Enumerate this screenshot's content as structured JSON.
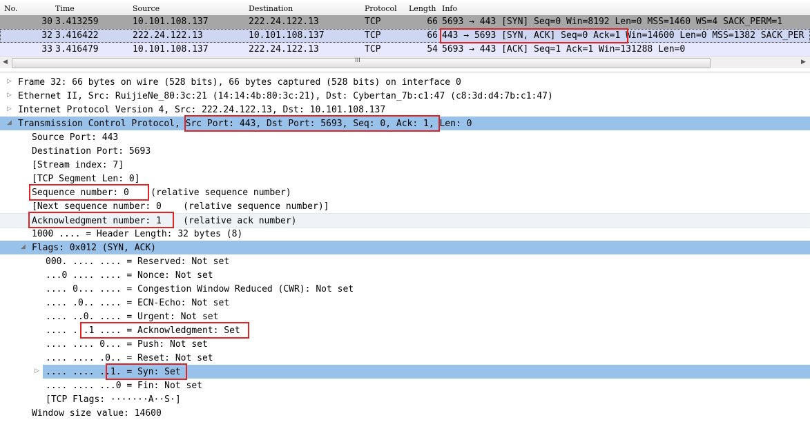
{
  "packet_list": {
    "columns": {
      "no": "No.",
      "time": "Time",
      "source": "Source",
      "destination": "Destination",
      "protocol": "Protocol",
      "length": "Length",
      "info": "Info"
    },
    "rows": [
      {
        "no": "30",
        "time": "3.413259",
        "source": "10.101.108.137",
        "destination": "222.24.122.13",
        "protocol": "TCP",
        "length": "66",
        "info": "5693 → 443 [SYN] Seq=0 Win=8192 Len=0 MSS=1460 WS=4 SACK_PERM=1"
      },
      {
        "no": "32",
        "time": "3.416422",
        "source": "222.24.122.13",
        "destination": "10.101.108.137",
        "protocol": "TCP",
        "length": "66",
        "info": "443 → 5693 [SYN, ACK] Seq=0 Ack=1 Win=14600 Len=0 MSS=1382 SACK_PER"
      },
      {
        "no": "33",
        "time": "3.416479",
        "source": "10.101.108.137",
        "destination": "222.24.122.13",
        "protocol": "TCP",
        "length": "54",
        "info": "5693 → 443 [ACK] Seq=1 Ack=1 Win=131288 Len=0"
      }
    ],
    "scrollbar_grip": "III"
  },
  "detail_tree": [
    {
      "text": "Frame 32: 66 bytes on wire (528 bits), 66 bytes captured (528 bits) on interface 0",
      "arrow": "▷"
    },
    {
      "text": "Ethernet II, Src: RuijieNe_80:3c:21 (14:14:4b:80:3c:21), Dst: Cybertan_7b:c1:47 (c8:3d:d4:7b:c1:47)",
      "arrow": "▷"
    },
    {
      "text": "Internet Protocol Version 4, Src: 222.24.122.13, Dst: 10.101.108.137",
      "arrow": "▷"
    },
    {
      "text": "Transmission Control Protocol, Src Port: 443, Dst Port: 5693, Seq: 0, Ack: 1, Len: 0",
      "arrow": "◢"
    },
    {
      "text": "Source Port: 443"
    },
    {
      "text": "Destination Port: 5693"
    },
    {
      "text": "[Stream index: 7]"
    },
    {
      "text": "[TCP Segment Len: 0]"
    },
    {
      "text": "Sequence number: 0    (relative sequence number)"
    },
    {
      "text": "[Next sequence number: 0    (relative sequence number)]"
    },
    {
      "text": "Acknowledgment number: 1    (relative ack number)"
    },
    {
      "text": "1000 .... = Header Length: 32 bytes (8)"
    },
    {
      "text": "Flags: 0x012 (SYN, ACK)",
      "arrow": "◢"
    },
    {
      "text": "000. .... .... = Reserved: Not set"
    },
    {
      "text": "...0 .... .... = Nonce: Not set"
    },
    {
      "text": ".... 0... .... = Congestion Window Reduced (CWR): Not set"
    },
    {
      "text": ".... .0.. .... = ECN-Echo: Not set"
    },
    {
      "text": ".... ..0. .... = Urgent: Not set"
    },
    {
      "text": ".... ...1 .... = Acknowledgment: Set"
    },
    {
      "text": ".... .... 0... = Push: Not set"
    },
    {
      "text": ".... .... .0.. = Reset: Not set"
    },
    {
      "text": ".... .... ..1. = Syn: Set",
      "arrow": "▷"
    },
    {
      "text": ".... .... ...0 = Fin: Not set"
    },
    {
      "text": "[TCP Flags: ·······A··S·]"
    },
    {
      "text": "Window size value: 14600"
    }
  ],
  "colors": {
    "row30_bg": "#a6a6a6",
    "row32_bg": "#cfd6f1",
    "row33_bg": "#e8e8ff",
    "selection": "#99c2ea",
    "annotation": "#e02424"
  }
}
